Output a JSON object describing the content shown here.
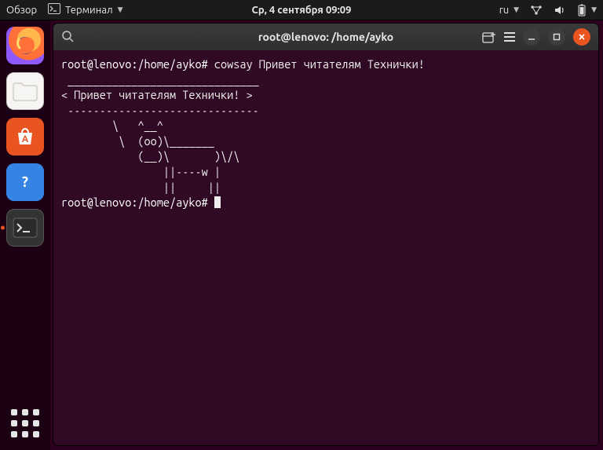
{
  "topbar": {
    "activities": "Обзор",
    "app_menu": "Терминал",
    "clock": "Ср, 4 сентября  09:09",
    "lang": "ru"
  },
  "launcher": {
    "items": [
      {
        "name": "firefox"
      },
      {
        "name": "files"
      },
      {
        "name": "software"
      },
      {
        "name": "help"
      },
      {
        "name": "terminal"
      }
    ]
  },
  "terminal": {
    "title": "root@lenovo: /home/ayko",
    "prompt1": "root@lenovo:/home/ayko#",
    "command1": "cowsay Привет читателям Технички!",
    "ascii": " ______________________________\n< Привет читателям Технички! >\n ------------------------------\n        \\   ^__^\n         \\  (oo)\\_______\n            (__)\\       )\\/\\\n                ||----w |\n                ||     ||",
    "prompt2": "root@lenovo:/home/ayko#"
  }
}
